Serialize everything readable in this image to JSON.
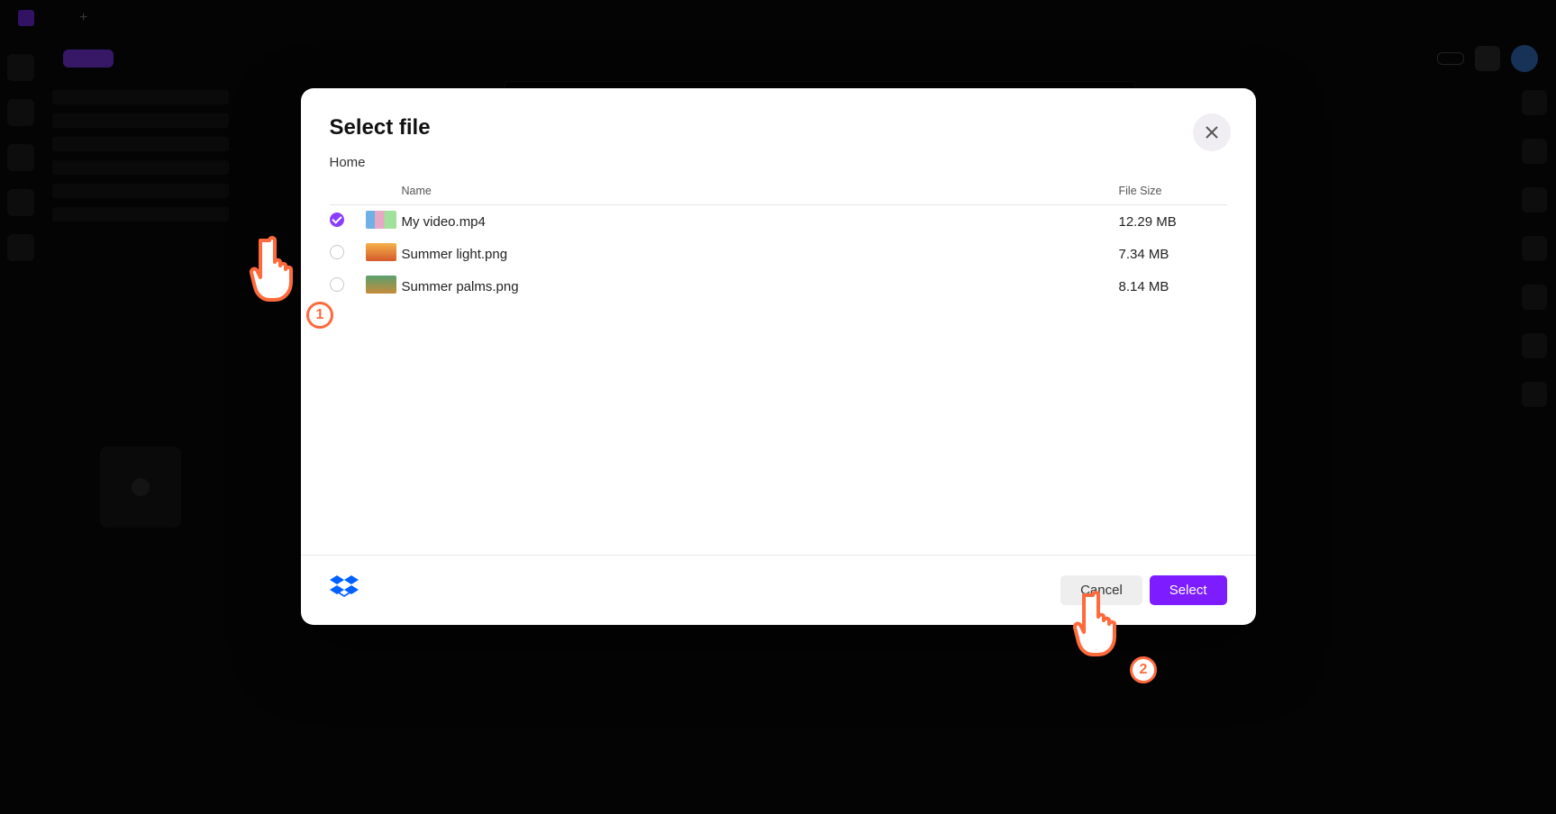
{
  "app": {
    "name": "",
    "active_tab": "",
    "primary_action": "",
    "upgrade_label": ""
  },
  "modal": {
    "title": "Select file",
    "breadcrumb": "Home",
    "columns": {
      "name": "Name",
      "size": "File Size"
    },
    "files": [
      {
        "name": "My video.mp4",
        "size": "12.29 MB",
        "selected": true
      },
      {
        "name": "Summer light.png",
        "size": "7.34 MB",
        "selected": false
      },
      {
        "name": "Summer palms.png",
        "size": "8.14 MB",
        "selected": false
      }
    ],
    "cancel_label": "Cancel",
    "select_label": "Select"
  },
  "annotations": {
    "step1": "1",
    "step2": "2"
  }
}
